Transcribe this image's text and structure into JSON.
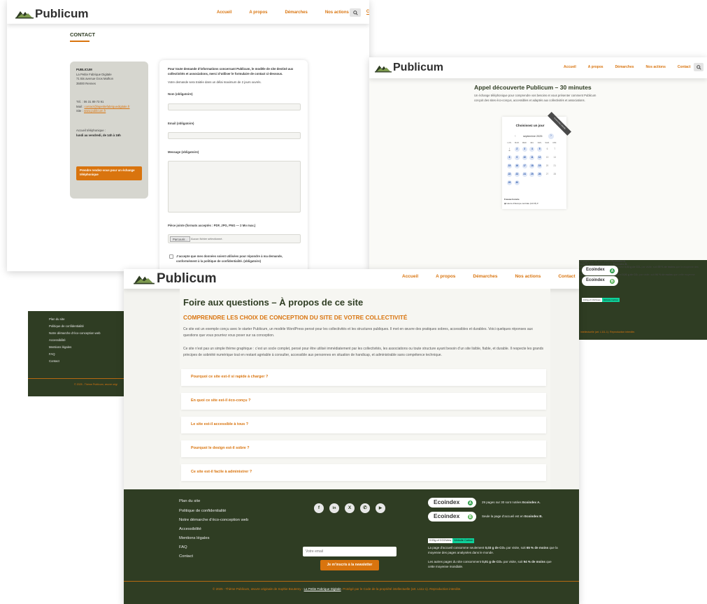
{
  "brand": {
    "name": "Publicum",
    "accent": "#d9740e",
    "dark": "#2f3d23"
  },
  "nav": {
    "items": [
      "Accueil",
      "A propos",
      "Démarches",
      "Nos actions",
      "Contact"
    ],
    "search_icon": "search-icon"
  },
  "contact": {
    "title": "CONTACT",
    "org_name": "PUBLICUM",
    "org_lines": [
      "La Petite Fabrique Digitale",
      "71 Bis avenue Gros Malhon",
      "35000 Rennes"
    ],
    "tel": "Tél. : 06 31 89 73 91",
    "mail_label": "Mail : ",
    "mail": "contact@lapetitefabriquedigitale.fr",
    "site_label": "Site : ",
    "site": "www.publicum.fr",
    "hours_label": "Accueil téléphonique :",
    "hours": "lundi au vendredi, de 14h à 16h",
    "rdv_button": "Prendre rendez-vous pour un échange téléphonique",
    "intro": "Pour toute demande d’informations concernant Publicum, le modèle de site destiné aux collectivités et associations, merci d’utiliser le formulaire de contact ci-dessous.",
    "delay": "Votre demande sera traitée dans un délai maximum de 2 jours ouvrés.",
    "name_label": "Nom (obligatoire)",
    "email_label": "Email (obligatoire)",
    "message_label": "Message (obligatoire)",
    "file_label": "Pièce jointe (formats acceptés : PDF, JPG, PNG — 2 Mo max.)",
    "file_button": "Parcourir...",
    "file_none": "Aucun fichier sélectionné.",
    "consent": "J’accepte que mes données soient utilisées pour répondre à ma demande, conformément à la politique de confidentialité. (obligatoire)"
  },
  "booking": {
    "title": "Appel découverte Publicum – 30 minutes",
    "desc": "Un échange téléphonique pour comprendre vos besoins et vous présenter comment Publicum conçoit des sites éco-conçus, accessibles et adaptés aux collectivités et associations.",
    "choose_day": "Choisissez un jour",
    "ribbon": "Powered by Calendly",
    "month": "septembre 2025",
    "prev": "‹",
    "next": "›",
    "weekdays": [
      "LUN.",
      "MAR.",
      "MER.",
      "JEU.",
      "VEN.",
      "SAM.",
      "DIM."
    ],
    "days": [
      "1",
      "2",
      "3",
      "4",
      "5",
      "6",
      "7",
      "8",
      "9",
      "10",
      "11",
      "12",
      "13",
      "14",
      "15",
      "16",
      "17",
      "18",
      "19",
      "20",
      "21",
      "22",
      "23",
      "24",
      "25",
      "26",
      "27",
      "28",
      "29",
      "30"
    ],
    "timezone_label": "Fuseau horaire",
    "timezone": "Heure d’Europe centrale (14:15) ▾"
  },
  "footer": {
    "links": [
      "Plan du site",
      "Politique de confidentialité",
      "Notre démarche d’éco-conception web",
      "Accessibilité",
      "Mentions légales",
      "FAQ",
      "Contact"
    ],
    "social": [
      "f",
      "in",
      "X",
      "✆",
      "▶"
    ],
    "social_icons": [
      "facebook-icon",
      "linkedin-icon",
      "x-icon",
      "whatsapp-icon",
      "youtube-icon"
    ],
    "email_placeholder": "Votre email",
    "newsletter_button": "Je m’inscris à la newsletter",
    "ecoindex": "Ecoindex",
    "grade_a": "A",
    "grade_b": "B",
    "eco_a_text_1": "29 pages sur 30 sont notées ",
    "eco_a_text_2": "Ecoindex A.",
    "eco_b_text_1": "Seule la page d’accueil est en ",
    "eco_b_text_2": "Ecoindex B.",
    "wc_left": "0.03g of CO2/view",
    "wc_right": "Website Carbon",
    "carbon_1a": "La page d’accueil consomme seulement ",
    "carbon_1b": "0,03 g de CO₂",
    "carbon_1c": " par visite, soit ",
    "carbon_1d": "65 % de moins",
    "carbon_1e": " que la moyenne des pages analysées dans le monde.",
    "carbon_2a": "Les autres pages du site consomment ",
    "carbon_2b": "0,01 g de CO₂",
    "carbon_2c": " par visite, soit ",
    "carbon_2d": "94 % de moins",
    "carbon_2e": " que cette moyenne mondiale.",
    "copyright_1": "© 2025 - Thème Publicum, œuvre originale de Sophie Boutemy - ",
    "copyright_link": "La Petite Fabrique Digitale",
    "copyright_2": ". Protégé par le Code de la propriété intellectuelle (art. L111-1). Reproduction interdite.",
    "copyright_short": "© 2025 - Thème Publicum, œuvre origi",
    "copyright_right": "intellectuelle (art. L111-1). Reproduction interdite."
  },
  "faq": {
    "title": "Foire aux questions – À propos de ce site",
    "subtitle": "COMPRENDRE LES CHOIX DE CONCEPTION DU SITE DE VOTRE COLLECTIVITÉ",
    "p1": "Ce site est un exemple conçu avec le starter Publicum, un modèle WordPress pensé pour les collectivités et les structures publiques. Il met en œuvre des pratiques sobres, accessibles et durables. Voici quelques réponses aux questions que vous pourriez vous poser sur sa conception.",
    "p2": "Ce site n’est pas un simple thème graphique : c’est un socle complet, pensé pour être utilisé immédiatement par les collectivités, les associations ou toute structure ayant besoin d’un site lisible, fiable, et durable. Il respecte les grands principes de sobriété numérique tout en restant agréable à consulter, accessible aux personnes en situation de handicap, et administrable sans compétence technique.",
    "questions": [
      "Pourquoi ce site est-il si rapide à charger ?",
      "En quoi ce site est-il éco-conçu ?",
      "Le site est-il accessible à tous ?",
      "Pourquoi le design est-il sobre ?",
      "Ce site est-il facile à administrer ?"
    ]
  }
}
